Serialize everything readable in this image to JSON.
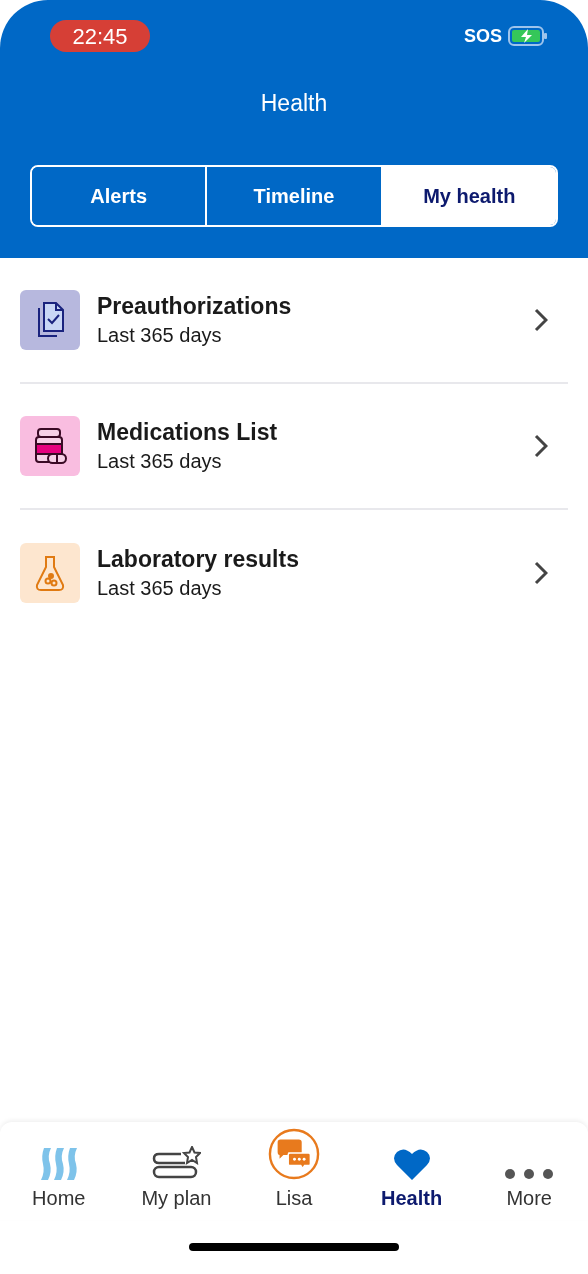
{
  "status_bar": {
    "time": "22:45",
    "sos": "SOS"
  },
  "title": "Health",
  "tabs": [
    {
      "label": "Alerts",
      "selected": false
    },
    {
      "label": "Timeline",
      "selected": false
    },
    {
      "label": "My health",
      "selected": true
    }
  ],
  "items": [
    {
      "kind": "document",
      "title": "Preauthorizations",
      "subtitle": "Last 365 days"
    },
    {
      "kind": "medication",
      "title": "Medications List",
      "subtitle": "Last 365 days"
    },
    {
      "kind": "lab",
      "title": "Laboratory results",
      "subtitle": "Last 365 days"
    }
  ],
  "nav": [
    {
      "kind": "home",
      "label": "Home",
      "selected": false
    },
    {
      "kind": "plan",
      "label": "My plan",
      "selected": false
    },
    {
      "kind": "chat",
      "label": "Lisa",
      "selected": false
    },
    {
      "kind": "heart",
      "label": "Health",
      "selected": true
    },
    {
      "kind": "more",
      "label": "More",
      "selected": false
    }
  ]
}
